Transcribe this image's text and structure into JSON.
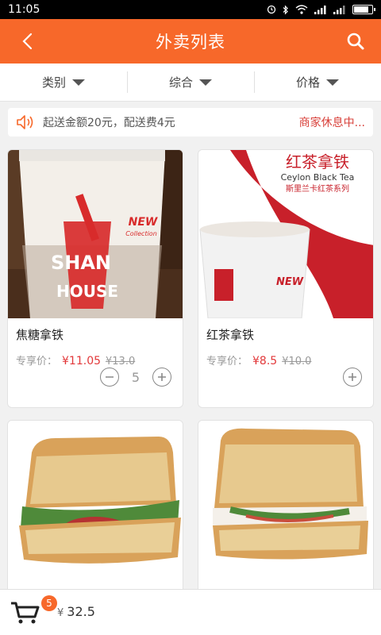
{
  "status_bar": {
    "time": "11:05"
  },
  "header": {
    "title": "外卖列表"
  },
  "filters": [
    {
      "label": "类别"
    },
    {
      "label": "综合"
    },
    {
      "label": "价格"
    }
  ],
  "notice": {
    "text": "起送金额20元，配送费4元",
    "status": "商家休息中..."
  },
  "products": [
    {
      "name": "焦糖拿铁",
      "price_label": "专享价：",
      "price": "¥11.05",
      "original_price": "¥13.0",
      "quantity": "5"
    },
    {
      "name": "红茶拿铁",
      "price_label": "专享价：",
      "price": "¥8.5",
      "original_price": "¥10.0",
      "quantity": ""
    },
    {
      "name": "",
      "price_label": "",
      "price": "",
      "original_price": "",
      "quantity": ""
    },
    {
      "name": "",
      "price_label": "",
      "price": "",
      "original_price": "",
      "quantity": ""
    }
  ],
  "image_text": {
    "cup_brand_1": "SHAN",
    "cup_brand_2": "HOUSE",
    "cup_new": "NEW",
    "cup_collection": "Collection",
    "banner_cn": "红茶拿铁",
    "banner_en": "Ceylon Black Tea",
    "banner_sub": "斯里兰卡红茶系列"
  },
  "cart": {
    "badge": "5",
    "currency": "¥",
    "total": "32.5"
  },
  "colors": {
    "accent": "#f7682a",
    "price": "#e2383a",
    "closed": "#d8403a"
  }
}
